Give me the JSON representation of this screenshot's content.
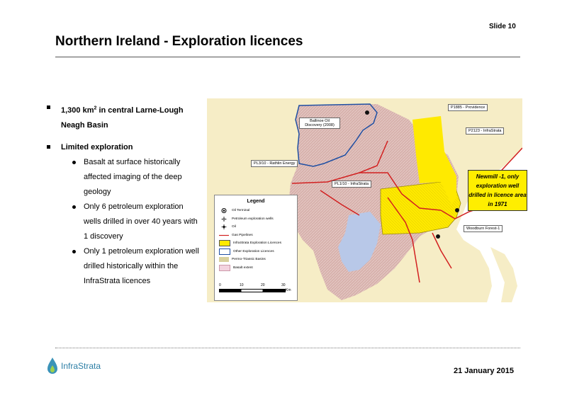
{
  "slide": {
    "number_label": "Slide 10",
    "title": "Northern Ireland - Exploration licences",
    "date": "21 January 2015"
  },
  "logo": {
    "name": "InfraStrata"
  },
  "bullets": [
    {
      "text_pre": "1,300 km",
      "sup": "2",
      "text_post": " in central Larne-Lough Neagh Basin"
    },
    {
      "text": "Limited exploration",
      "sub": [
        "Basalt at surface historically affected imaging of the deep geology",
        "Only 6 petroleum exploration wells drilled in over 40 years with 1 discovery",
        "Only 1 petroleum exploration well drilled historically within the InfraStrata licences"
      ]
    }
  ],
  "map": {
    "labels": {
      "p1885": "P1885 - Providence",
      "p2123": "P2123 - InfraStrata",
      "ballinoe": "Ballinoe Oil Discovery (2008)",
      "pl310": "PL3/10 - Rathlin Energy",
      "pl110": "PL1/10 - InfraStrata",
      "woodburn": "Woodburn Forest-1"
    },
    "callout": "Newmill -1, only exploration well drilled in licence area in 1971",
    "legend": {
      "title": "Legend",
      "items": [
        {
          "icon": "oil-terminal-icon",
          "label": "Oil Terminal"
        },
        {
          "icon": "petroleum-well-icon",
          "label": "Petroleum exploration wells"
        },
        {
          "icon": "oil-icon",
          "label": "Oil"
        },
        {
          "icon": "gas-pipeline-icon",
          "label": "Gas Pipelines"
        },
        {
          "icon": "infrastrata-licence-swatch",
          "label": "InfraStrata Exploration Licences"
        },
        {
          "icon": "other-licence-swatch",
          "label": "Other Exploration Licences"
        },
        {
          "icon": "permo-triassic-swatch",
          "label": "Permo-Triassic Basins"
        },
        {
          "icon": "basalt-swatch",
          "label": "Basalt extent"
        }
      ],
      "scale_ticks": [
        "0",
        "10",
        "20",
        "30"
      ],
      "scale_unit": "Km"
    },
    "colors": {
      "sea": "#ffffff",
      "land": "#f6edc6",
      "basalt": "#d8b3ae",
      "licence": "#ffee00",
      "lough": "#b8c8e8",
      "pipeline": "#d22020",
      "other_licence": "#1f4fa3"
    }
  }
}
